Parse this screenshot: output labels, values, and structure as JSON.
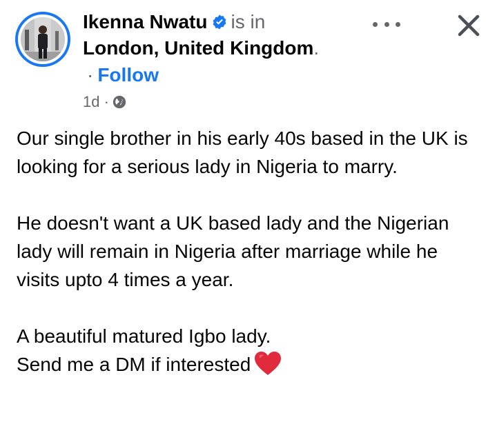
{
  "post": {
    "author": {
      "name": "Ikenna Nwatu",
      "verified": true,
      "avatar_icon": "profile-photo"
    },
    "checkin": {
      "prefix": "is in",
      "location": "London, United Kingdom",
      "suffix": "."
    },
    "follow": {
      "separator": "·",
      "label": "Follow"
    },
    "meta": {
      "time": "1d",
      "separator": "·",
      "audience_icon": "globe-icon"
    },
    "controls": {
      "more_icon": "more-horizontal-icon",
      "close_icon": "close-icon"
    },
    "body": {
      "paragraph1": "Our single brother in his early 40s based in the UK is looking for a serious lady in Nigeria to marry.",
      "paragraph2": "He doesn't want a UK based lady and the Nigerian lady will remain in Nigeria after marriage while he visits upto 4 times a year.",
      "paragraph3_line1": "A beautiful matured Igbo lady.",
      "paragraph3_line2": "Send me a DM if interested",
      "emoji_icon": "red-heart-icon"
    },
    "colors": {
      "accent": "#1877f2",
      "secondary_text": "#65676b",
      "primary_text": "#050505",
      "heart": "#e0245e"
    }
  }
}
